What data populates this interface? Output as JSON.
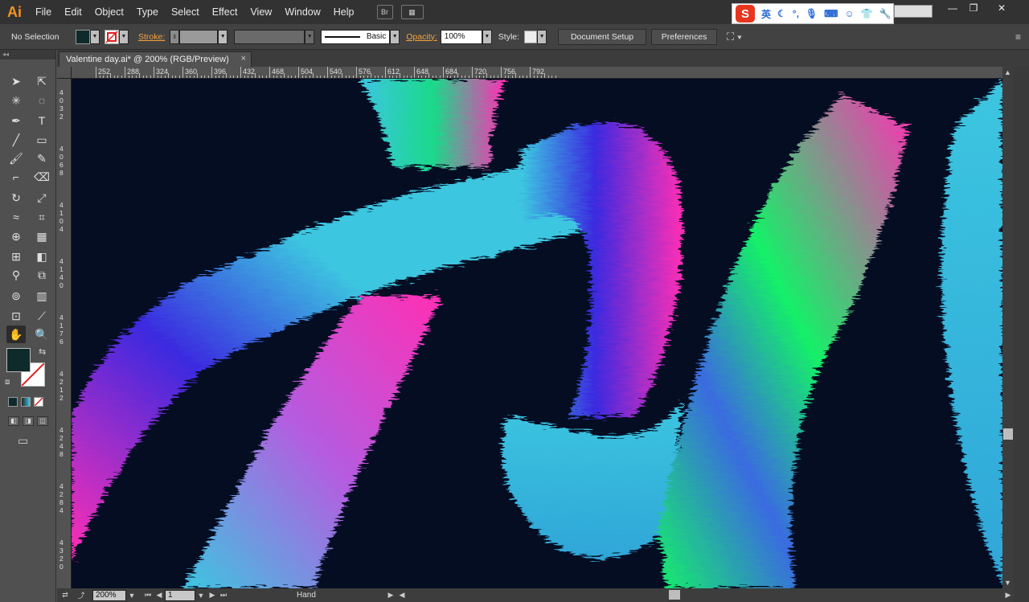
{
  "app": {
    "logo": "Ai"
  },
  "menu": [
    "File",
    "Edit",
    "Object",
    "Type",
    "Select",
    "Effect",
    "View",
    "Window",
    "Help"
  ],
  "menubar_buttons": {
    "bridge": "Br",
    "arrange": "▦"
  },
  "ime": {
    "logo": "S",
    "lang": "英"
  },
  "window_controls": {
    "minimize": "—",
    "restore": "❐",
    "close": "✕"
  },
  "controlbar": {
    "selection": "No Selection",
    "stroke_label": "Stroke:",
    "brush": "Basic",
    "opacity_label": "Opacity:",
    "opacity_value": "100%",
    "style_label": "Style:",
    "document_setup": "Document Setup",
    "preferences": "Preferences"
  },
  "document": {
    "tab_title": "Valentine day.ai* @ 200% (RGB/Preview)",
    "close": "×"
  },
  "ruler": {
    "h_labels": [
      "252",
      "288",
      "324",
      "360",
      "396",
      "432",
      "468",
      "504",
      "540",
      "576",
      "612",
      "648",
      "684",
      "720",
      "756",
      "792"
    ],
    "v_labels": [
      "4 0 3 2",
      "4 0 6 8",
      "4 1 0 4",
      "4 1 4 0",
      "4 1 7 6",
      "4 2 1 2",
      "4 2 4 8",
      "4 2 8 4",
      "4 3 2 0"
    ]
  },
  "status": {
    "zoom": "200%",
    "page": "1",
    "tool": "Hand"
  },
  "colors": {
    "canvas_bg": "#050d23",
    "fill_swatch": "#0f2a2a",
    "accent_orange": "#f7931e",
    "fur_cyan": "#3cc6e0",
    "fur_blue": "#3a2be0",
    "fur_magenta": "#ff2fb4",
    "fur_green": "#15f068"
  }
}
